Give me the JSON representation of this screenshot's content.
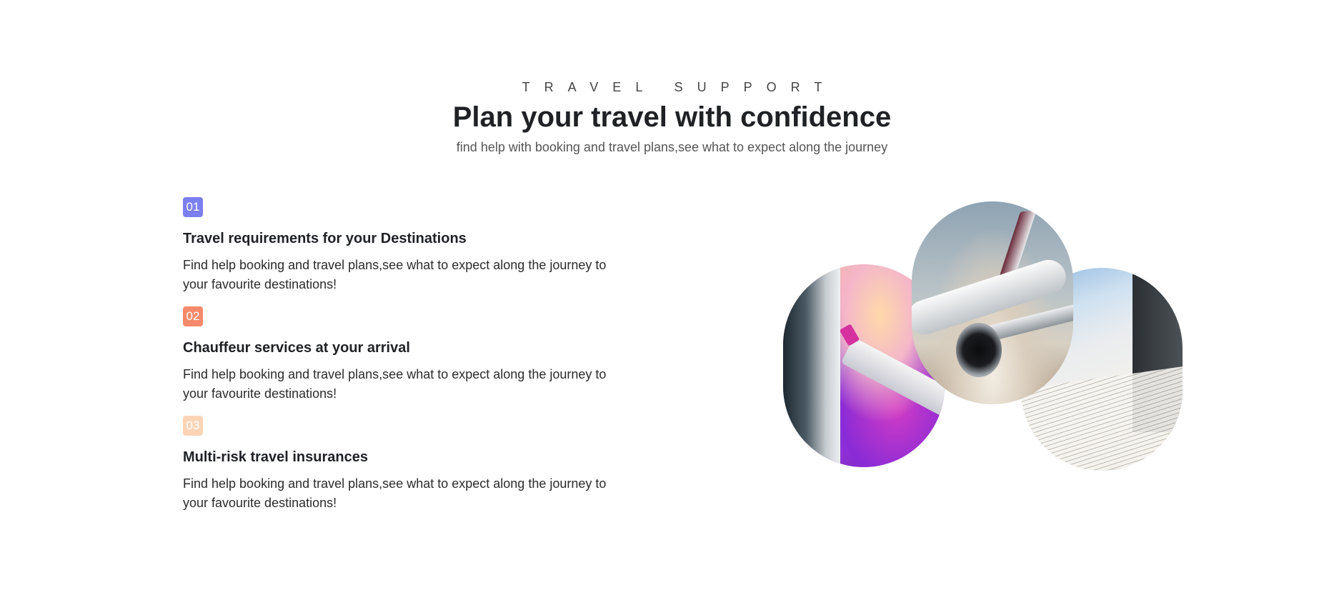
{
  "header": {
    "eyebrow": "TRAVEL SUPPORT",
    "title": "Plan your travel with confidence",
    "subtitle": "find help with booking and travel plans,see what to expect along the journey"
  },
  "features": [
    {
      "number": "01",
      "badge_color": "#7b7ff0",
      "title": "Travel requirements for your Destinations",
      "description": "Find help booking and travel plans,see what to expect along the journey to your favourite destinations!"
    },
    {
      "number": "02",
      "badge_color": "#f58a6b",
      "title": "Chauffeur services at your arrival",
      "description": "Find help booking and travel plans,see what to expect along the journey to your favourite destinations!"
    },
    {
      "number": "03",
      "badge_color": "#fbd4b6",
      "title": "Multi-risk travel insurances",
      "description": "Find help booking and travel plans,see what to expect along the journey to your favourite destinations!"
    }
  ],
  "collage": {
    "images": [
      {
        "icon": "airplane-window-sunset-image"
      },
      {
        "icon": "airplane-in-flight-image"
      },
      {
        "icon": "book-by-window-image"
      }
    ]
  }
}
